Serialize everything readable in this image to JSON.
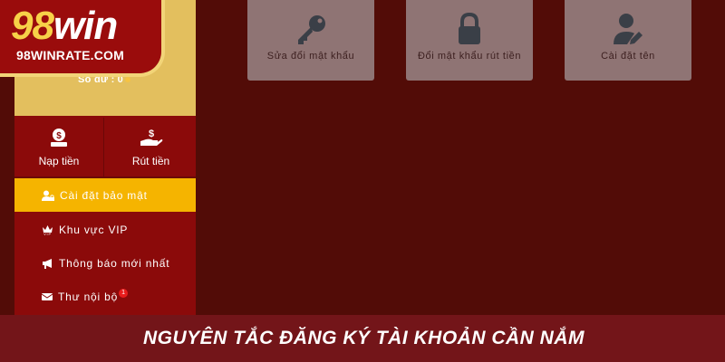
{
  "brand": {
    "logo_main_num": "98",
    "logo_main_word": "win",
    "logo_site": "98WINRATE.COM"
  },
  "profile": {
    "balance_label": "Số dư :",
    "balance_value": "0"
  },
  "actions": {
    "deposit_label": "Nạp tiền",
    "withdraw_label": "Rút tiền"
  },
  "menu": [
    {
      "label": "Cài đặt bảo mật",
      "icon": "user-lock-icon",
      "active": true
    },
    {
      "label": "Khu vực VIP",
      "icon": "vip-crown-icon",
      "active": false
    },
    {
      "label": "Thông báo mới nhất",
      "icon": "megaphone-icon",
      "active": false
    },
    {
      "label": "Thư nội bộ",
      "icon": "envelope-icon",
      "active": false,
      "badge": "1"
    }
  ],
  "tiles": [
    {
      "label": "Sửa đổi mật khẩu",
      "icon": "key-icon"
    },
    {
      "label": "Đổi mật khẩu rút tiền",
      "icon": "lock-icon"
    },
    {
      "label": "Cài đặt tên",
      "icon": "user-edit-icon"
    }
  ],
  "banner": {
    "text": "NGUYÊN TẮC ĐĂNG KÝ TÀI KHOẢN CẦN NẮM"
  },
  "colors": {
    "background": "#520c07",
    "sidebar": "#8b0a0a",
    "profile_gold": "#e3bf5e",
    "active_item": "#f5b400",
    "tile": "#8f7474",
    "banner": "#731519"
  }
}
